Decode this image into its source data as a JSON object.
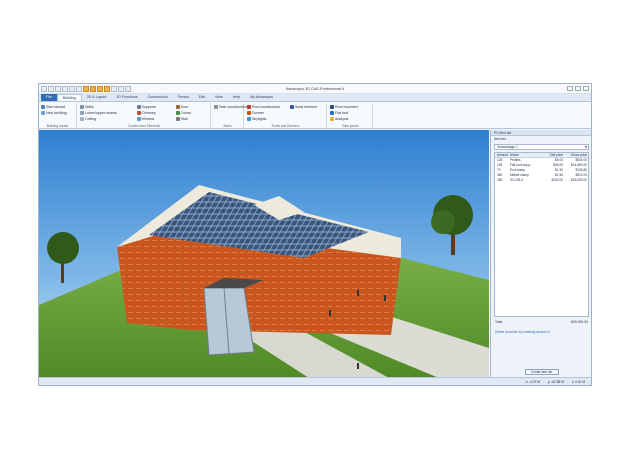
{
  "window": {
    "title": "Ashampoo 3D CAD Professional 6"
  },
  "tabs": [
    {
      "label": "File"
    },
    {
      "label": "Building"
    },
    {
      "label": "2D & Layout"
    },
    {
      "label": "3D Functions"
    },
    {
      "label": "Construction"
    },
    {
      "label": "Terrain"
    },
    {
      "label": "Edit"
    },
    {
      "label": "View"
    },
    {
      "label": "Help"
    },
    {
      "label": "My Ashampoo"
    }
  ],
  "ribbon": {
    "groups": [
      {
        "label": "Building wizard",
        "items": [
          "Start wizard",
          "New building"
        ]
      },
      {
        "label": "Construction Elements",
        "items": [
          "Walls",
          "Lower/upper beams",
          "Ceiling",
          "Supports",
          "Chimney",
          "Window",
          "Door",
          "Cutout",
          "Stair"
        ]
      },
      {
        "label": "Stairs",
        "items": [
          "Stair construction"
        ]
      },
      {
        "label": "Roofs and Dormers",
        "items": [
          "Roof construction",
          "Dormer",
          "Skylights",
          "Solar element"
        ]
      },
      {
        "label": "Solar plants",
        "items": [
          "Roof mounted",
          "Flat roof",
          "Analysis"
        ]
      }
    ]
  },
  "panel": {
    "title": "PV item list",
    "tab": "Item list",
    "selector": "Solaranlage 1",
    "columns": [
      "Amount",
      "Article",
      "Unit price",
      "Gross price"
    ],
    "rows": [
      [
        "126",
        "Profiles",
        "$5.00",
        "$504.00"
      ],
      [
        "128",
        "Flat roof supp...",
        "$45.00",
        "$14,850.00"
      ],
      [
        "72",
        "End clamp",
        "$1.90",
        "$136.80"
      ],
      [
        "340",
        "Middle clamp",
        "$1.50",
        "$510.00"
      ],
      [
        "330",
        "SV-235-2",
        "$100.00",
        "$33,000.00"
      ]
    ],
    "total_label": "Total",
    "total_value": "$49,000.00",
    "note": "Delete an article by resetting amount 0.",
    "button": "Create item list"
  },
  "status": {
    "coord_x": "x: -4.07 M",
    "coord_y": "y: -62.68 M",
    "zoom": "z: 0.00 M"
  },
  "colors": {
    "accent": "#2f6fb8",
    "facade": "#c9561f",
    "grass": "#5f9a2f"
  }
}
